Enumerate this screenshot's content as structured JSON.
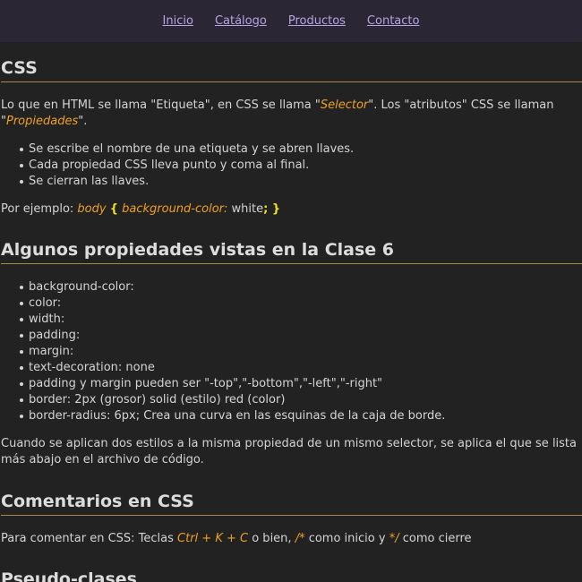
{
  "nav": {
    "links": [
      "Inicio",
      "Catálogo",
      "Productos",
      "Contacto"
    ]
  },
  "section_css": {
    "title": "CSS",
    "intro_1": "Lo que en HTML se llama \"Etiqueta\", en CSS se llama \"",
    "intro_selector": "Selector",
    "intro_2": "\". Los \"atributos\" CSS se llaman \"",
    "intro_propiedades": "Propiedades",
    "intro_3": "\".",
    "list": [
      "Se escribe el nombre de una etiqueta y se abren llaves.",
      "Cada propiedad CSS lleva punto y coma al final.",
      "Se cierran las llaves."
    ],
    "example_prefix": "Por ejemplo: ",
    "example_selector": "body",
    "example_open": "{",
    "example_property": "background-color:",
    "example_value": " white",
    "example_close": "; }"
  },
  "section_props": {
    "title": "Algunos propiedades vistas en la Clase 6",
    "list": [
      "background-color:",
      "color:",
      "width:",
      "padding:",
      "margin:",
      "text-decoration: none",
      "padding y margin pueden ser \"-top\",\"-bottom\",\"-left\",\"-right\"",
      "border: 2px (grosor) solid (estilo) red (color)",
      "border-radius: 6px; Crea una curva en las esquinas de la caja de borde."
    ],
    "note": "Cuando se aplican dos estilos a la misma propiedad de un mismo selector, se aplica el que se lista más abajo en el archivo de código."
  },
  "section_comments": {
    "title": "Comentarios en CSS",
    "text_1": "Para comentar en CSS: Teclas ",
    "keys": "Ctrl + K + C",
    "text_2": " o bien, ",
    "open_comment": "/*",
    "text_3": " como inicio y ",
    "close_comment": "*/",
    "text_4": " como cierre"
  },
  "section_pseudo": {
    "title": "Pseudo-clases"
  }
}
